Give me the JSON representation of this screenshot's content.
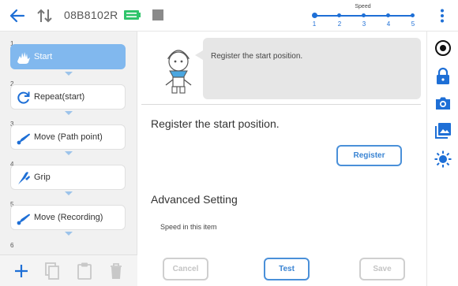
{
  "header": {
    "robot_id": "08B8102R",
    "speed": {
      "label": "Speed",
      "levels": [
        "1",
        "2",
        "3",
        "4",
        "5"
      ],
      "selected": 1
    }
  },
  "steps": [
    {
      "number": "1",
      "label": "Start",
      "icon": "start-hand-icon",
      "active": true
    },
    {
      "number": "2",
      "label": "Repeat(start)",
      "icon": "repeat-icon",
      "active": false
    },
    {
      "number": "3",
      "label": "Move (Path point)",
      "icon": "robot-arm-icon",
      "active": false
    },
    {
      "number": "4",
      "label": "Grip",
      "icon": "gripper-icon",
      "active": false
    },
    {
      "number": "5",
      "label": "Move (Recording)",
      "icon": "robot-arm-icon",
      "active": false
    },
    {
      "number": "6",
      "label": "",
      "icon": "",
      "active": false
    }
  ],
  "main": {
    "bubble_text": "Register the start position.",
    "section_title": "Register the start position.",
    "register_label": "Register",
    "advanced_title": "Advanced Setting",
    "speed_item_label": "Speed in this item",
    "cancel_label": "Cancel",
    "test_label": "Test",
    "save_label": "Save"
  },
  "colors": {
    "accent": "#1e6fd6",
    "active_step": "#81b8ee",
    "battery": "#2fc46a"
  }
}
